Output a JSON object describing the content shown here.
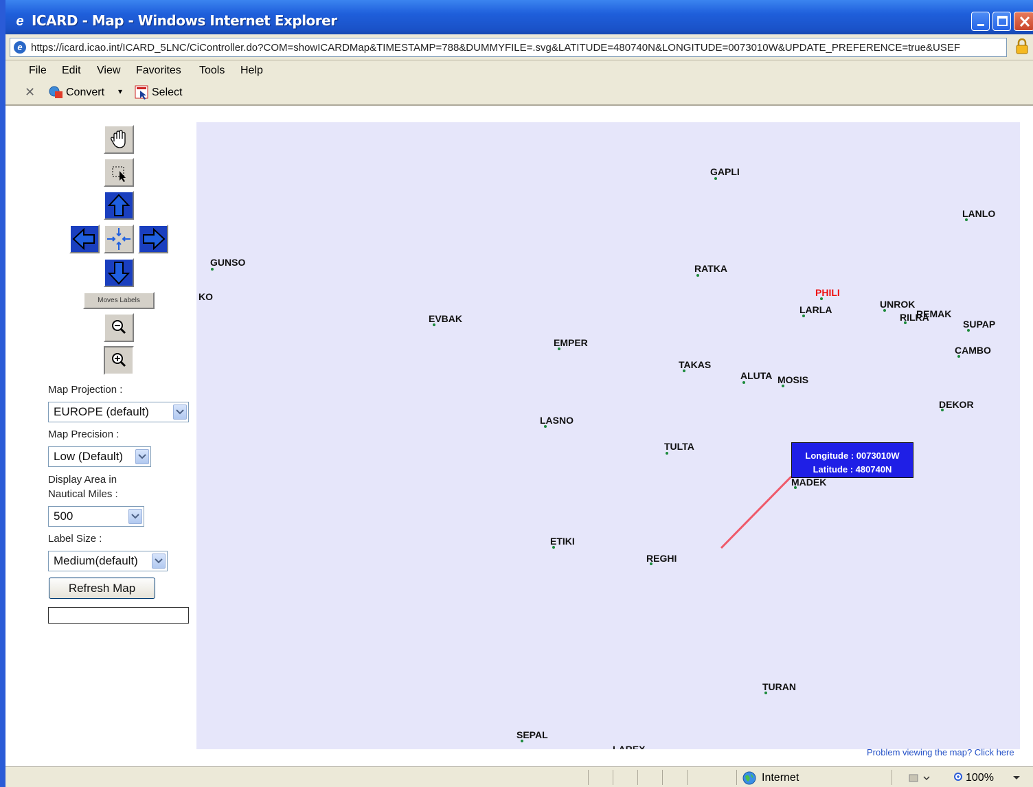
{
  "window": {
    "title": "ICARD - Map - Windows Internet Explorer",
    "min_label": "_",
    "max_label": "□",
    "close_label": "X"
  },
  "address_bar": {
    "url": "https://icard.icao.int/ICARD_5LNC/CiController.do?COM=showICARDMap&TIMESTAMP=788&DUMMYFILE=.svg&LATITUDE=480740N&LONGITUDE=0073010W&UPDATE_PREFERENCE=true&USEF"
  },
  "menu": [
    "File",
    "Edit",
    "View",
    "Favorites",
    "Tools",
    "Help"
  ],
  "toolbar": {
    "close_label": "✕",
    "convert_label": "Convert",
    "dropdown_label": "▾",
    "select_label": "Select"
  },
  "controls": {
    "moves_labels": "Moves Labels",
    "map_projection_label": "Map Projection :",
    "map_projection_value": "EUROPE (default)",
    "map_precision_label": "Map Precision :",
    "map_precision_value": "Low (Default)",
    "display_area_label_1": "Display Area in",
    "display_area_label_2": "Nautical Miles :",
    "display_area_value": "500",
    "label_size_label": "Label Size :",
    "label_size_value": "Medium(default)",
    "refresh_label": "Refresh Map",
    "status_value": ""
  },
  "map": {
    "background": "#e6e6fa",
    "waypoints": [
      "GAPLI",
      "LANLO",
      "GUNSO",
      "RATKA",
      "KO",
      "PHILI",
      "LARLA",
      "UNROK",
      "RILRA",
      "REMAK",
      "EVBAK",
      "SUPAP",
      "EMPER",
      "CAMBO",
      "TAKAS",
      "ALUTA",
      "MOSIS",
      "DEKOR",
      "LASNO",
      "TULTA",
      "MADEK",
      "ETIKI",
      "REGHI",
      "TURAN",
      "SEPAL",
      "LAREX"
    ],
    "highlighted_waypoint": "PHILI",
    "highlight_color": "#ee1111",
    "tooltip": {
      "longitude": "Longitude : 0073010W",
      "latitude": "Latitude : 480740N"
    },
    "problem_link": "Problem viewing the map? Click here"
  },
  "status_bar": {
    "zone": "Internet",
    "zoom": "100%"
  }
}
